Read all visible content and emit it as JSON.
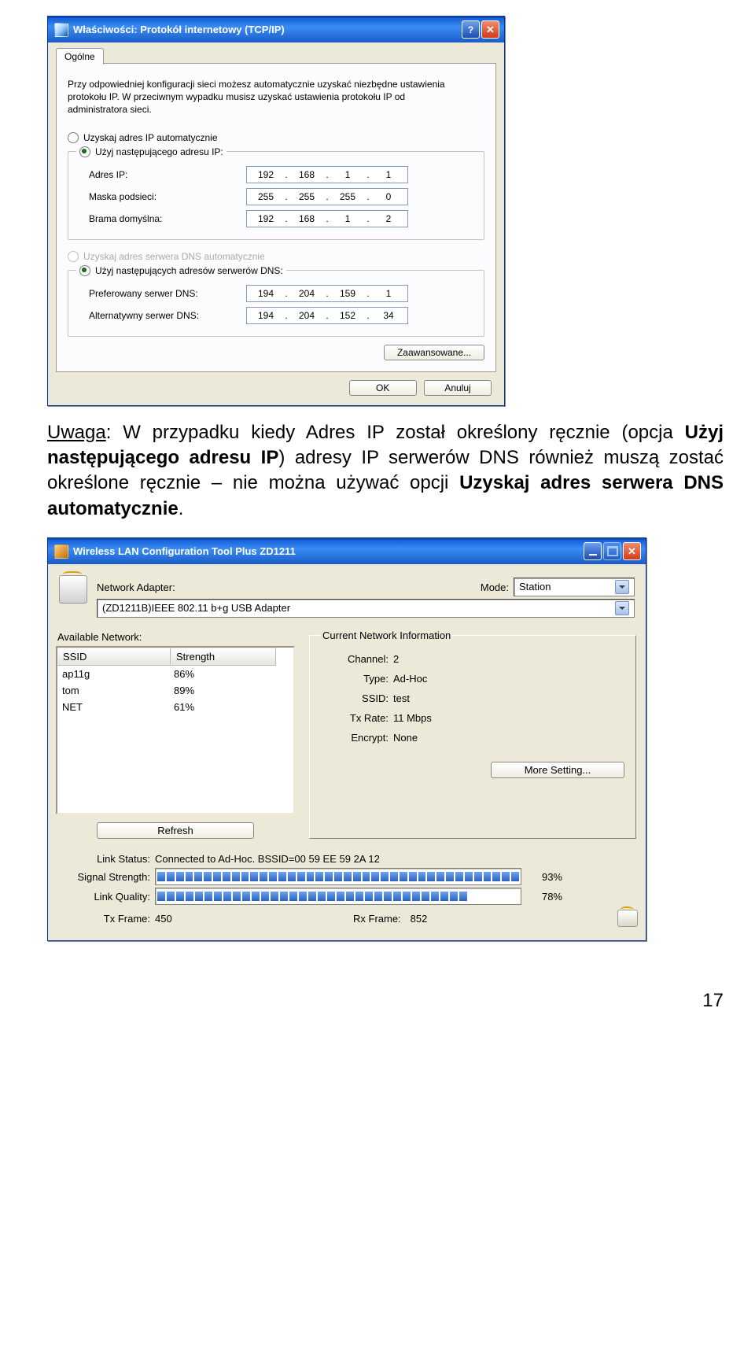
{
  "dialog1": {
    "title": "Właściwości: Protokół internetowy (TCP/IP)",
    "tab": "Ogólne",
    "intro": "Przy odpowiedniej konfiguracji sieci możesz automatycznie uzyskać niezbędne ustawienia protokołu IP. W przeciwnym wypadku musisz uzyskać ustawienia protokołu IP od administratora sieci.",
    "radio_auto_ip": "Uzyskaj adres IP automatycznie",
    "radio_manual_ip": "Użyj następującego adresu IP:",
    "field_ip_label": "Adres IP:",
    "field_mask_label": "Maska podsieci:",
    "field_gw_label": "Brama domyślna:",
    "ip": {
      "a": "192",
      "b": "168",
      "c": "1",
      "d": "1"
    },
    "mask": {
      "a": "255",
      "b": "255",
      "c": "255",
      "d": "0"
    },
    "gw": {
      "a": "192",
      "b": "168",
      "c": "1",
      "d": "2"
    },
    "radio_auto_dns": "Uzyskaj adres serwera DNS automatycznie",
    "radio_manual_dns": "Użyj następujących adresów serwerów DNS:",
    "field_dns1_label": "Preferowany serwer DNS:",
    "field_dns2_label": "Alternatywny serwer DNS:",
    "dns1": {
      "a": "194",
      "b": "204",
      "c": "159",
      "d": "1"
    },
    "dns2": {
      "a": "194",
      "b": "204",
      "c": "152",
      "d": "34"
    },
    "advanced_btn": "Zaawansowane...",
    "ok_btn": "OK",
    "cancel_btn": "Anuluj"
  },
  "note": {
    "prefix": "Uwaga",
    "part1": ": W przypadku kiedy Adres IP został określony ręcznie (opcja ",
    "bold1": "Użyj następującego adresu IP",
    "part2": ") adresy IP serwerów DNS również muszą zostać określone ręcznie – nie można używać opcji ",
    "bold2": "Uzyskaj adres serwera DNS automatycznie",
    "end": "."
  },
  "dialog2": {
    "title": "Wireless LAN Configuration Tool Plus   ZD1211",
    "lbl_adapter": "Network Adapter:",
    "lbl_mode": "Mode:",
    "mode_value": "Station",
    "adapter_value": "(ZD1211B)IEEE 802.11 b+g USB Adapter",
    "lbl_available": "Available Network:",
    "col_ssid": "SSID",
    "col_strength": "Strength",
    "networks": [
      {
        "ssid": "ap11g",
        "strength": "86%"
      },
      {
        "ssid": "tom",
        "strength": "89%"
      },
      {
        "ssid": "NET",
        "strength": "61%"
      }
    ],
    "btn_refresh": "Refresh",
    "legend_current": "Current Network Information",
    "channel_k": "Channel:",
    "channel_v": "2",
    "type_k": "Type:",
    "type_v": "Ad-Hoc",
    "ssid_k": "SSID:",
    "ssid_v": "test",
    "rate_k": "Tx Rate:",
    "rate_v": "11 Mbps",
    "encrypt_k": "Encrypt:",
    "encrypt_v": "None",
    "btn_more": "More Setting...",
    "link_status_k": "Link Status:",
    "link_status_v": "Connected to Ad-Hoc. BSSID=00 59 EE 59 2A 12",
    "sig_k": "Signal Strength:",
    "sig_v": "93%",
    "lq_k": "Link Quality:",
    "lq_v": "78%",
    "txframe_k": "Tx Frame:",
    "txframe_v": "450",
    "rxframe_k": "Rx Frame:",
    "rxframe_v": "852"
  },
  "pagenum": "17",
  "progress": {
    "sig_segs": 39,
    "lq_segs": 33
  }
}
